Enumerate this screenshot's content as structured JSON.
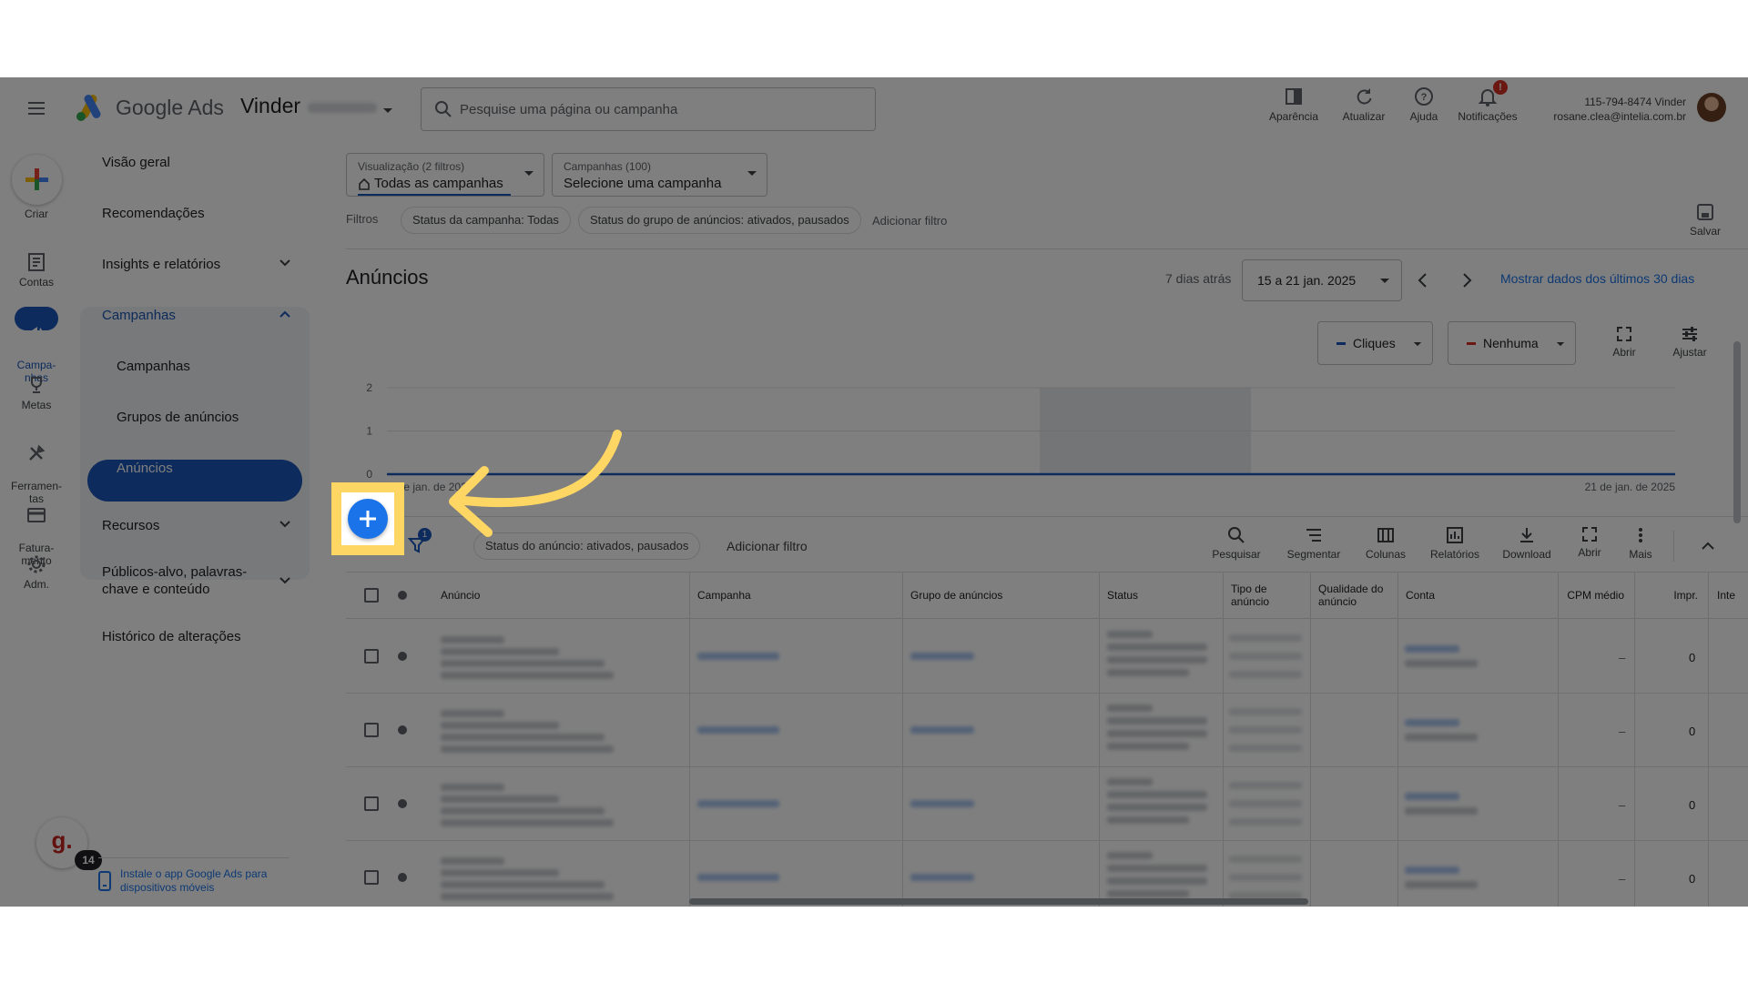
{
  "header": {
    "brand": "Google Ads",
    "account_name": "Vinder",
    "search_placeholder": "Pesquise uma página ou campanha",
    "tools": [
      {
        "label": "Aparência",
        "icon": "appearance-icon"
      },
      {
        "label": "Atualizar",
        "icon": "refresh-icon"
      },
      {
        "label": "Ajuda",
        "icon": "help-icon"
      },
      {
        "label": "Notificações",
        "icon": "bell-icon"
      }
    ],
    "notification_badge": "!",
    "user_id": "115-794-8474 Vinder",
    "user_email": "rosane.clea@intelia.com.br"
  },
  "rail": [
    {
      "label": "Criar",
      "icon": "plus-icon"
    },
    {
      "label": "Contas",
      "icon": "accounts-icon"
    },
    {
      "label": "Campa-\nnhas",
      "icon": "megaphone-icon"
    },
    {
      "label": "Metas",
      "icon": "trophy-icon"
    },
    {
      "label": "Ferramen-\ntas",
      "icon": "tools-icon"
    },
    {
      "label": "Fatura-\nmento",
      "icon": "billing-icon"
    },
    {
      "label": "Adm.",
      "icon": "gear-icon"
    }
  ],
  "nav": {
    "overview": "Visão geral",
    "recommendations": "Recomendações",
    "insights": "Insights e relatórios",
    "campaigns_group": "Campanhas",
    "campaigns": "Campanhas",
    "ad_groups": "Grupos de anúncios",
    "ads": "Anúncios",
    "resources": "Recursos",
    "audiences": "Públicos-alvo, palavras-\nchave e conteúdo",
    "history": "Histórico de alterações",
    "install_app": "Instale o app Google Ads para\ndispositivos móveis"
  },
  "helper": {
    "letter": "g.",
    "count": "14"
  },
  "filters_bar": {
    "view_label": "Visualização (2 filtros)",
    "view_value": "Todas as campanhas",
    "campaigns_label": "Campanhas (100)",
    "campaigns_value": "Selecione uma campanha",
    "filters_label": "Filtros",
    "chips": [
      "Status da campanha: Todas",
      "Status do grupo de anúncios: ativados, pausados"
    ],
    "add_filter": "Adicionar filtro",
    "save": "Salvar"
  },
  "page": {
    "title": "Anúncios",
    "date_prefix": "7 dias atrás",
    "date_range": "15 a 21 jan. 2025",
    "show_30": "Mostrar dados dos últimos 30 dias",
    "metric1": "Cliques",
    "metric2": "Nenhuma",
    "expand": "Abrir",
    "adjust": "Ajustar"
  },
  "chart_data": {
    "type": "line",
    "x": [
      "15 de jan. de 2025",
      "21 de jan. de 2025"
    ],
    "series": [
      {
        "name": "Cliques",
        "values": [
          0,
          0,
          0,
          0,
          0,
          0,
          0
        ]
      }
    ],
    "ylim": [
      0,
      2
    ],
    "y_ticks": [
      "2",
      "1",
      "0"
    ],
    "x_start_label": "15 de jan. de 2025",
    "x_end_label": "21 de jan. de 2025",
    "colors": {
      "line": "#1a56b8",
      "highlight": "#e8eaed"
    }
  },
  "table_toolbar": {
    "filter_count": "1",
    "status_chip": "Status do anúncio: ativados, pausados",
    "add_filter": "Adicionar filtro",
    "actions": [
      {
        "label": "Pesquisar",
        "icon": "search-icon"
      },
      {
        "label": "Segmentar",
        "icon": "segment-icon"
      },
      {
        "label": "Colunas",
        "icon": "columns-icon"
      },
      {
        "label": "Relatórios",
        "icon": "reports-icon"
      },
      {
        "label": "Download",
        "icon": "download-icon"
      },
      {
        "label": "Abrir",
        "icon": "expand-icon"
      },
      {
        "label": "Mais",
        "icon": "more-icon"
      }
    ]
  },
  "table": {
    "columns": [
      "Anúncio",
      "Campanha",
      "Grupo de anúncios",
      "Status",
      "Tipo de\nanúncio",
      "Qualidade do\nanúncio",
      "Conta",
      "CPM médio",
      "Impr.",
      "Inte"
    ],
    "rows": [
      {
        "cpm": "–",
        "impr": "0"
      },
      {
        "cpm": "–",
        "impr": "0"
      },
      {
        "cpm": "–",
        "impr": "0"
      },
      {
        "cpm": "–",
        "impr": "0"
      }
    ]
  },
  "colors": {
    "accent": "#1a56b8",
    "highlight": "#fdd663",
    "fab": "#1a73e8"
  }
}
